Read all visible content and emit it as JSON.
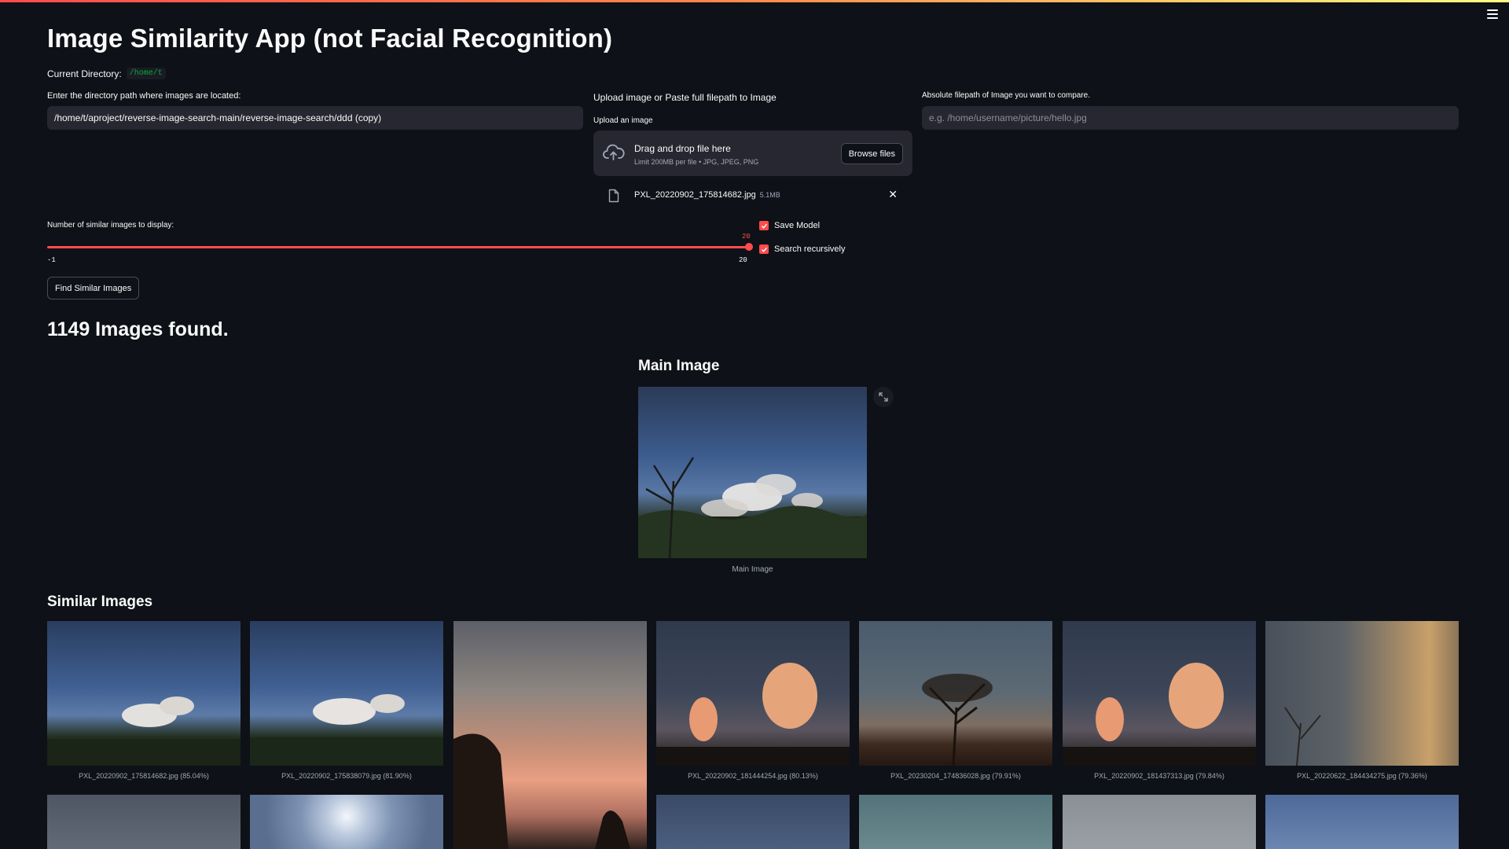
{
  "app": {
    "title": "Image Similarity App (not Facial Recognition)",
    "current_directory_label": "Current Directory:",
    "current_directory_value": "/home/t"
  },
  "directory_input": {
    "label": "Enter the directory path where images are located:",
    "value": "/home/t/aproject/reverse-image-search-main/reverse-image-search/ddd (copy)"
  },
  "upload": {
    "section_title": "Upload image or Paste full filepath to Image",
    "label": "Upload an image",
    "drop_text": "Drag and drop file here",
    "limit_text": "Limit 200MB per file • JPG, JPEG, PNG",
    "browse_label": "Browse files",
    "file_name": "PXL_20220902_175814682.jpg",
    "file_size": "5.1MB"
  },
  "filepath_input": {
    "label": "Absolute filepath of Image you want to compare.",
    "placeholder": "e.g. /home/username/picture/hello.jpg"
  },
  "slider": {
    "label": "Number of similar images to display:",
    "value": "20",
    "min": "-1",
    "max": "20"
  },
  "checkboxes": {
    "save_model": "Save Model",
    "search_recursively": "Search recursively"
  },
  "find_button": "Find Similar Images",
  "results": {
    "count_text": "1149 Images found.",
    "main_heading": "Main Image",
    "main_caption": "Main Image",
    "similar_heading": "Similar Images",
    "thumbnails": [
      "PXL_20220902_175814682.jpg (85.04%)",
      "PXL_20220902_175838079.jpg (81.90%)",
      "",
      "PXL_20220902_181444254.jpg (80.13%)",
      "PXL_20230204_174836028.jpg (79.91%)",
      "PXL_20220902_181437313.jpg (79.84%)",
      "PXL_20220622_184434275.jpg (79.36%)"
    ]
  },
  "colors": {
    "background": "#0e1117",
    "accent": "#ff4b4b",
    "input_bg": "#262730",
    "code_green": "#09ab3b"
  }
}
